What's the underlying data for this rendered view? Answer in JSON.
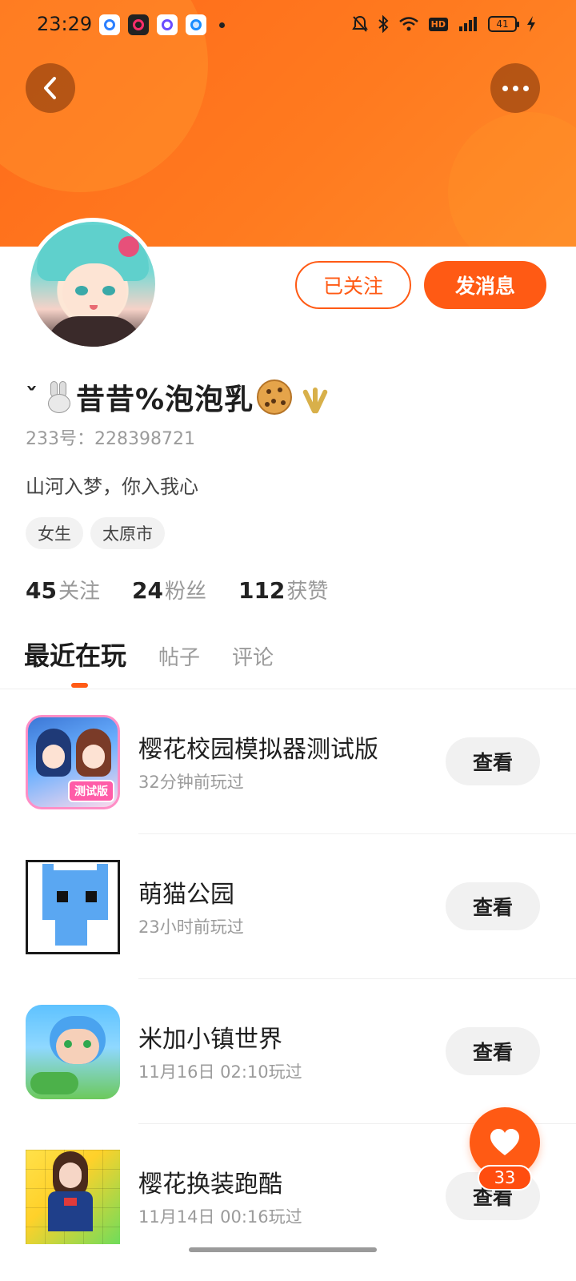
{
  "status_bar": {
    "time": "23:29",
    "battery": "41",
    "hd": "HD",
    "network": "4G"
  },
  "header": {
    "back_icon": "chevron-left-icon",
    "more_icon": "more-horizontal-icon"
  },
  "profile": {
    "name_prefix": "ˇ",
    "name": "昔昔%泡泡乳",
    "uid": "233号：228398721",
    "bio": "山河入梦，你入我心",
    "tags": [
      "女生",
      "太原市"
    ],
    "follow_label": "已关注",
    "message_label": "发消息",
    "stats": [
      {
        "num": "45",
        "label": "关注"
      },
      {
        "num": "24",
        "label": "粉丝"
      },
      {
        "num": "112",
        "label": "获赞"
      }
    ]
  },
  "tabs": [
    "最近在玩",
    "帖子",
    "评论"
  ],
  "games": [
    {
      "title": "樱花校园模拟器测试版",
      "time": "32分钟前玩过",
      "button": "查看",
      "icon_badge": "测试版"
    },
    {
      "title": "萌猫公园",
      "time": "23小时前玩过",
      "button": "查看"
    },
    {
      "title": "米加小镇世界",
      "time": "11月16日 02:10玩过",
      "button": "查看"
    },
    {
      "title": "樱花换装跑酷",
      "time": "11月14日 00:16玩过",
      "button": "查看"
    }
  ],
  "fab": {
    "icon": "heart-icon",
    "count": "33"
  },
  "colors": {
    "accent": "#ff5a14",
    "banner": "#ff7a1f"
  }
}
